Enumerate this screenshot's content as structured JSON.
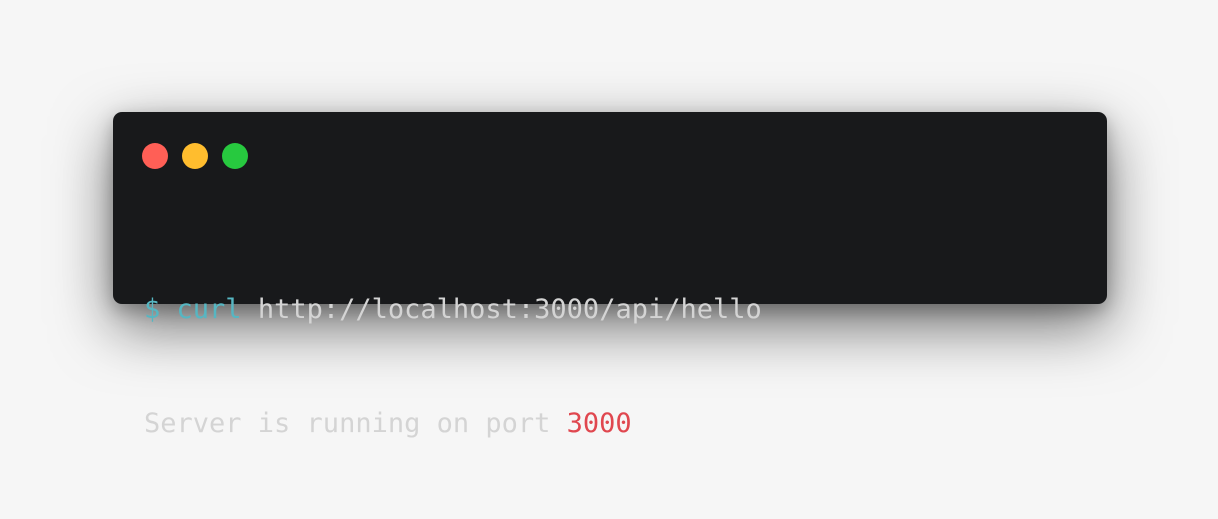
{
  "window": {
    "controls": [
      {
        "name": "close",
        "color": "#ff5f56"
      },
      {
        "name": "minimize",
        "color": "#ffbd2e"
      },
      {
        "name": "maximize",
        "color": "#27c93f"
      }
    ]
  },
  "terminal": {
    "command_line": {
      "prompt": "$",
      "command": "curl",
      "argument": "http://localhost:3000/api/hello"
    },
    "output_line": {
      "text": "Server is running on port",
      "port": "3000"
    }
  },
  "colors": {
    "background": "#18191b",
    "prompt": "#56b6c2",
    "text": "#d4d4d4",
    "number": "#e0474f"
  }
}
